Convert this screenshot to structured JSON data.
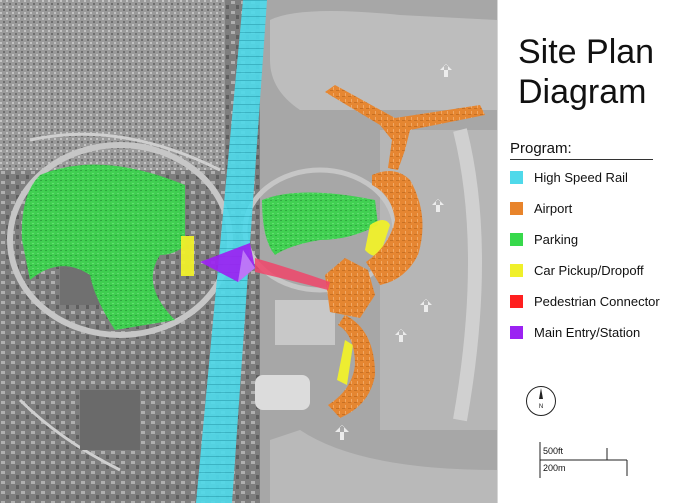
{
  "title": {
    "line1": "Site Plan",
    "line2": "Diagram"
  },
  "legend": {
    "heading": "Program:",
    "items": [
      {
        "label": "High Speed Rail",
        "color": "#4fd9ea"
      },
      {
        "label": "Airport",
        "color": "#e8842b"
      },
      {
        "label": "Parking",
        "color": "#37d94b"
      },
      {
        "label": "Car Pickup/Dropoff",
        "color": "#f0f02a"
      },
      {
        "label": "Pedestrian Connector",
        "color": "#ff1f1f"
      },
      {
        "label": "Main Entry/Station",
        "color": "#9b22f2"
      }
    ]
  },
  "compass": {
    "label": "N"
  },
  "scale": {
    "imperial": "500ft",
    "metric": "200m"
  }
}
